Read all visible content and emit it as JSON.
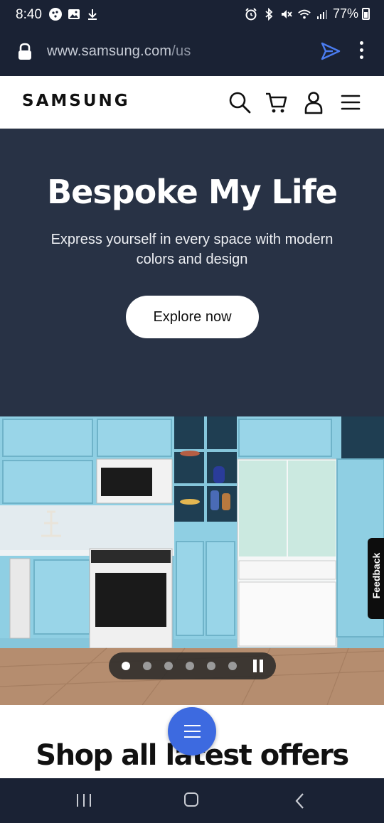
{
  "status_bar": {
    "time": "8:40",
    "battery": "77%",
    "icons": [
      "gallery-icon",
      "image-icon",
      "download-icon",
      "alarm-icon",
      "bluetooth-icon",
      "mute-icon",
      "wifi-icon",
      "signal-icon",
      "battery-icon"
    ]
  },
  "browser": {
    "url_domain": "www.samsung.com",
    "url_path": "/us"
  },
  "header": {
    "logo": "SAMSUNG"
  },
  "hero": {
    "title": "Bespoke My Life",
    "subtitle": "Express yourself in every space with modern colors and design",
    "cta": "Explore now"
  },
  "carousel": {
    "slide_count": 6,
    "active_index": 0
  },
  "feedback": {
    "label": "Feedback"
  },
  "offers": {
    "title": "Shop all latest offers"
  },
  "colors": {
    "system_bar": "#1a2234",
    "hero_bg": "#283245",
    "fab": "#3d6ae0",
    "send_icon": "#4a7cf0"
  }
}
